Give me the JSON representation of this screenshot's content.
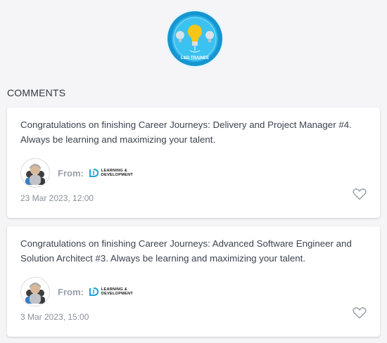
{
  "badge": {
    "label": "L&D TRAINEE"
  },
  "section": {
    "title": "COMMENTS"
  },
  "comments": [
    {
      "text": "Congratulations on finishing Career Journeys: Delivery and Project Manager #4. Always be learning and maximizing your talent.",
      "from_label": "From:",
      "sender_line1": "LEARNING &",
      "sender_line2": "DEVELOPMENT",
      "date": "23 Mar 2023, 12:00",
      "icon": "heart-outline"
    },
    {
      "text": "Congratulations on finishing Career Journeys: Advanced Software Engineer and Solution Architect #3. Always be learning and maximizing your talent.",
      "from_label": "From:",
      "sender_line1": "LEARNING &",
      "sender_line2": "DEVELOPMENT",
      "date": "3 Mar 2023, 15:00",
      "icon": "heart-outline"
    }
  ],
  "colors": {
    "accent": "#19a3dd",
    "bulb": "#f5c518",
    "heart": "#9aa0a8"
  }
}
